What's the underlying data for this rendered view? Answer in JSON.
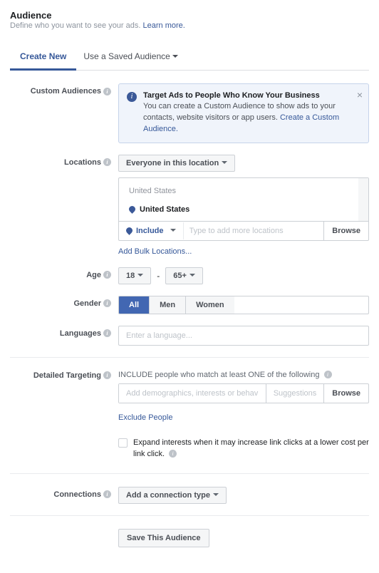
{
  "header": {
    "title": "Audience",
    "subtitle": "Define who you want to see your ads.",
    "learn_more": "Learn more."
  },
  "tabs": {
    "create": "Create New",
    "saved": "Use a Saved Audience"
  },
  "custom_audiences": {
    "label": "Custom Audiences",
    "notice_title": "Target Ads to People Who Know Your Business",
    "notice_body": "You can create a Custom Audience to show ads to your contacts, website visitors or app users.",
    "notice_link": "Create a Custom Audience."
  },
  "locations": {
    "label": "Locations",
    "dropdown": "Everyone in this location",
    "group_label": "United States",
    "selected": "United States",
    "include": "Include",
    "placeholder": "Type to add more locations",
    "browse": "Browse",
    "bulk_link": "Add Bulk Locations..."
  },
  "age": {
    "label": "Age",
    "min": "18",
    "dash": "-",
    "max": "65+"
  },
  "gender": {
    "label": "Gender",
    "all": "All",
    "men": "Men",
    "women": "Women"
  },
  "languages": {
    "label": "Languages",
    "placeholder": "Enter a language..."
  },
  "detailed": {
    "label": "Detailed Targeting",
    "include_text": "INCLUDE people who match at least ONE of the following",
    "placeholder": "Add demographics, interests or behaviors",
    "suggestions": "Suggestions",
    "browse": "Browse",
    "exclude": "Exclude People",
    "expand": "Expand interests when it may increase link clicks at a lower cost per link click."
  },
  "connections": {
    "label": "Connections",
    "dropdown": "Add a connection type"
  },
  "save": "Save This Audience"
}
